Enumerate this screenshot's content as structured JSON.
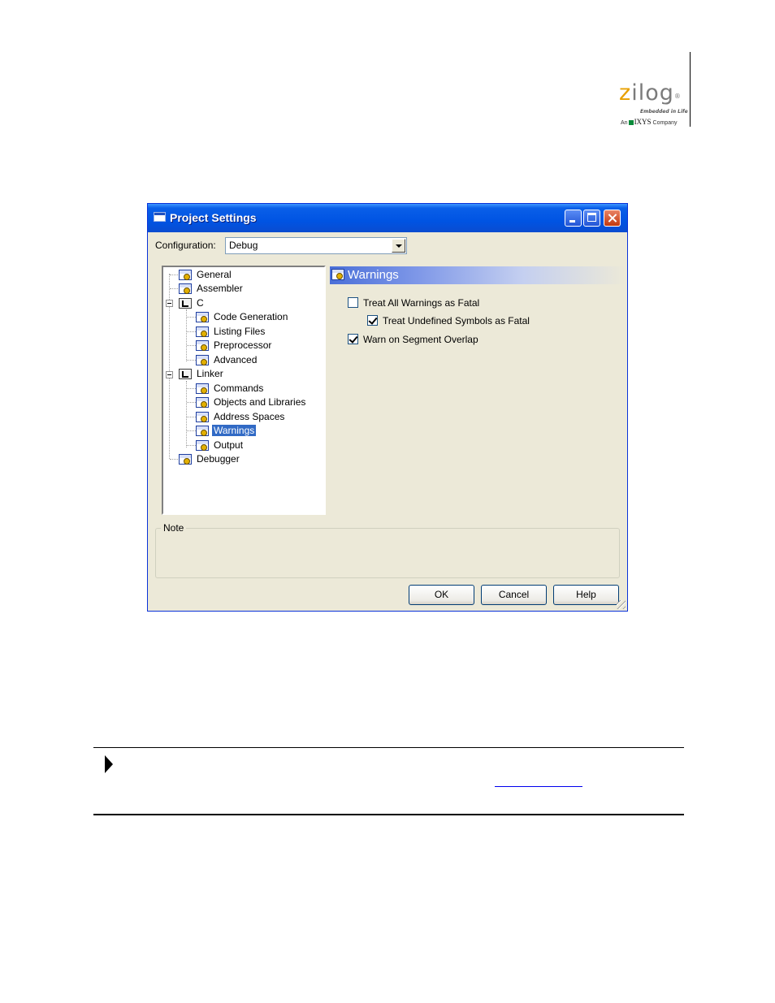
{
  "logo": {
    "z": "z",
    "word_rest": "ilog",
    "trademark": "®",
    "tagline": "Embedded in Life",
    "company_prefix": "An",
    "company_name": "IXYS",
    "company_suffix": "Company",
    "brand_color": "#e8a000"
  },
  "dialog": {
    "title": "Project Settings",
    "configuration_label": "Configuration:",
    "configuration_value": "Debug",
    "tree": [
      {
        "label": "General",
        "icon": "gear-icon"
      },
      {
        "label": "Assembler",
        "icon": "gear-icon"
      },
      {
        "label": "C",
        "icon": "folder-icon",
        "expanded": true
      },
      {
        "label": "Code Generation",
        "icon": "gear-icon"
      },
      {
        "label": "Listing Files",
        "icon": "gear-icon"
      },
      {
        "label": "Preprocessor",
        "icon": "gear-icon"
      },
      {
        "label": "Advanced",
        "icon": "gear-icon"
      },
      {
        "label": "Linker",
        "icon": "folder-icon",
        "expanded": true
      },
      {
        "label": "Commands",
        "icon": "gear-icon"
      },
      {
        "label": "Objects and Libraries",
        "icon": "gear-icon"
      },
      {
        "label": "Address Spaces",
        "icon": "gear-icon"
      },
      {
        "label": "Warnings",
        "icon": "gear-icon",
        "selected": true
      },
      {
        "label": "Output",
        "icon": "gear-icon"
      },
      {
        "label": "Debugger",
        "icon": "gear-icon"
      }
    ],
    "panel_title": "Warnings",
    "options": [
      {
        "label": "Treat All Warnings as Fatal",
        "checked": false
      },
      {
        "label": "Treat Undefined Symbols as Fatal",
        "checked": true
      },
      {
        "label": "Warn on Segment Overlap",
        "checked": true
      }
    ],
    "note_label": "Note",
    "buttons": {
      "ok": "OK",
      "cancel": "Cancel",
      "help": "Help"
    },
    "accent_color": "#0054e3",
    "selection_color": "#316ac5"
  }
}
